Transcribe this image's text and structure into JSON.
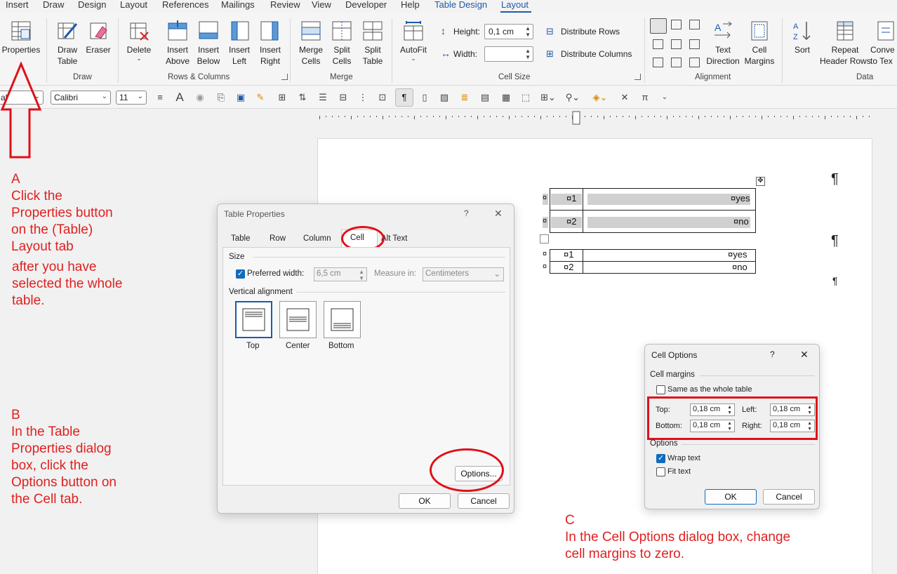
{
  "menu": {
    "tabs": [
      "Insert",
      "Draw",
      "Design",
      "Layout",
      "References",
      "Mailings",
      "Review",
      "View",
      "Developer",
      "Help",
      "Table Design",
      "Layout"
    ]
  },
  "ribbon": {
    "properties": "Properties",
    "draw_table": "Draw\nTable",
    "eraser": "Eraser",
    "delete": "Delete",
    "insert_above": "Insert\nAbove",
    "insert_below": "Insert\nBelow",
    "insert_left": "Insert\nLeft",
    "insert_right": "Insert\nRight",
    "merge_cells": "Merge\nCells",
    "split_cells": "Split\nCells",
    "split_table": "Split\nTable",
    "autofit": "AutoFit",
    "height_label": "Height:",
    "height_value": "0,1 cm",
    "width_label": "Width:",
    "width_value": "",
    "distribute_rows": "Distribute Rows",
    "distribute_columns": "Distribute Columns",
    "text_direction": "Text\nDirection",
    "cell_margins": "Cell\nMargins",
    "sort": "Sort",
    "repeat_header_rows": "Repeat\nHeader Rows",
    "convert_to_text": "Conve\nto Tex",
    "groups": {
      "draw": "Draw",
      "rows_columns": "Rows & Columns",
      "merge": "Merge",
      "cell_size": "Cell Size",
      "alignment": "Alignment",
      "data": "Data"
    }
  },
  "toolbar2": {
    "style_value": "al",
    "font_value": "Calibri",
    "size_value": "11"
  },
  "annotations": {
    "a": "A\nClick the\nProperties button\non the (Table)\nLayout tab",
    "a2": "after you have\nselected the whole\ntable.",
    "b": "B\nIn the Table\nProperties dialog\nbox, click the\nOptions button on\nthe Cell tab.",
    "c": "C\nIn the Cell Options dialog box, change\ncell margins to zero."
  },
  "table_properties": {
    "title": "Table Properties",
    "help": "?",
    "close": "✕",
    "tabs": [
      "Table",
      "Row",
      "Column",
      "Cell",
      "Alt Text"
    ],
    "size_label": "Size",
    "preferred_width_label": "Preferred width:",
    "preferred_width_value": "6,5 cm",
    "measure_in_label": "Measure in:",
    "measure_in_value": "Centimeters",
    "vertical_alignment_label": "Vertical alignment",
    "align_top": "Top",
    "align_center": "Center",
    "align_bottom": "Bottom",
    "options_button": "Options...",
    "ok": "OK",
    "cancel": "Cancel"
  },
  "cell_options": {
    "title": "Cell Options",
    "help": "?",
    "close": "✕",
    "cell_margins_label": "Cell margins",
    "same_as_whole_table": "Same as the whole table",
    "top_label": "Top:",
    "top_value": "0,18 cm",
    "bottom_label": "Bottom:",
    "bottom_value": "0,18 cm",
    "left_label": "Left:",
    "left_value": "0,18 cm",
    "right_label": "Right:",
    "right_value": "0,18 cm",
    "options_label": "Options",
    "wrap_text": "Wrap text",
    "fit_text": "Fit text",
    "ok": "OK",
    "cancel": "Cancel"
  },
  "document": {
    "pilcrow": "¶",
    "table1": [
      {
        "num": "¤1",
        "val": "¤yes"
      },
      {
        "num": "¤2",
        "val": "¤no"
      }
    ],
    "table2": [
      {
        "num": "¤1",
        "val": "¤yes"
      },
      {
        "num": "¤2",
        "val": "¤no"
      }
    ],
    "cell_mark": "¤"
  }
}
